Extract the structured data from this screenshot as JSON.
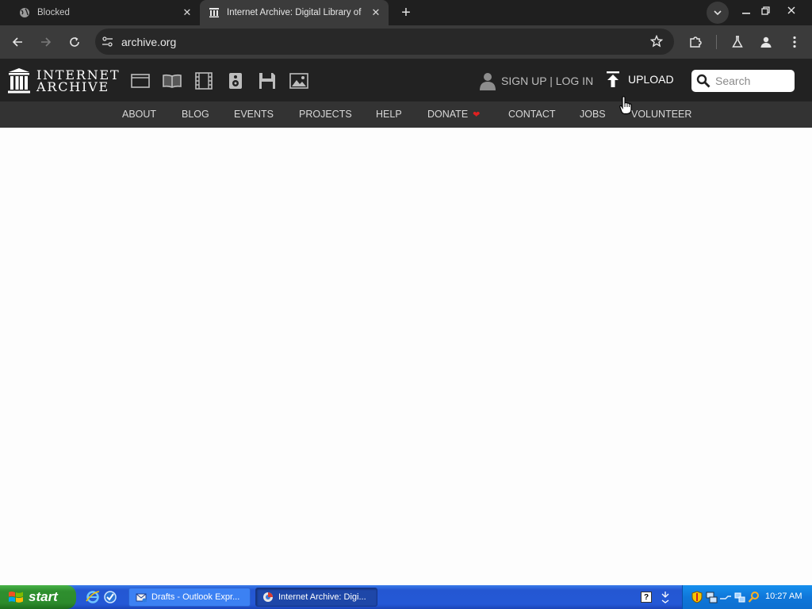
{
  "browser": {
    "tabs": [
      {
        "title": "Blocked",
        "icon": "globe-icon"
      },
      {
        "title": "Internet Archive: Digital Library of",
        "icon": "archive-icon"
      }
    ],
    "url": "archive.org"
  },
  "ia": {
    "logo": {
      "line1": "INTERNET",
      "line2": "ARCHIVE"
    },
    "media_icons": [
      "web-icon",
      "texts-icon",
      "video-icon",
      "audio-icon",
      "software-icon",
      "images-icon"
    ],
    "auth_label": "SIGN UP | LOG IN",
    "upload_label": "UPLOAD",
    "search_placeholder": "Search",
    "nav": [
      "ABOUT",
      "BLOG",
      "EVENTS",
      "PROJECTS",
      "HELP",
      "DONATE",
      "CONTACT",
      "JOBS",
      "VOLUNTEER"
    ]
  },
  "taskbar": {
    "start_label": "start",
    "tasks": [
      "Drafts - Outlook Expr...",
      "Internet Archive: Digi..."
    ],
    "clock": "10:27 AM"
  },
  "colors": {
    "ia_header": "#222222",
    "ia_nav": "#333333",
    "donate_heart": "#e02020",
    "xp_taskbar": "#2458d6",
    "xp_start": "#2f8f2f"
  }
}
